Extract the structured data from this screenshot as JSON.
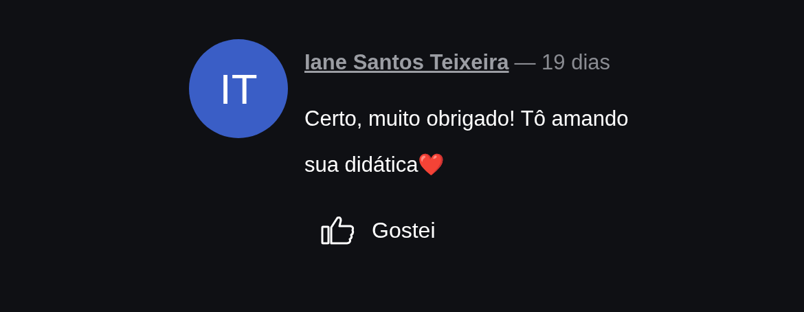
{
  "comment": {
    "avatar_initials": "IT",
    "author": "Iane Santos Teixeira",
    "age": "— 19 dias",
    "text": "Certo, muito obrigado! Tô amando sua didática❤️",
    "like_label": "Gostei"
  }
}
